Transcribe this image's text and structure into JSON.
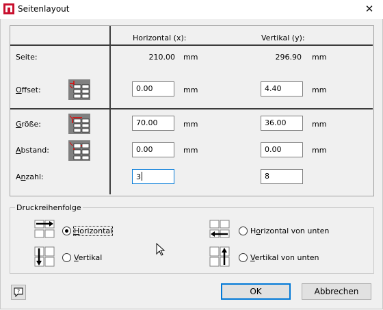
{
  "window": {
    "title": "Seitenlayout",
    "close_glyph": "✕"
  },
  "table": {
    "header_x": "Horizontal (x):",
    "header_y": "Vertikal (y):",
    "unit": "mm",
    "rows": {
      "seite": {
        "label": "Seite:",
        "x": "210.00",
        "y": "296.90"
      },
      "offset": {
        "label": "Offset:",
        "x": "0.00",
        "y": "4.40"
      },
      "groesse": {
        "label": "Größe:",
        "x": "70.00",
        "y": "36.00"
      },
      "abstand": {
        "label": "Abstand:",
        "x": "0.00",
        "y": "0.00"
      },
      "anzahl": {
        "label": "Anzahl:",
        "x": "3",
        "y": "8"
      }
    }
  },
  "print_order": {
    "title": "Druckreihenfolge",
    "options": [
      {
        "label": "Horizontal",
        "checked": true
      },
      {
        "label": "Vertikal",
        "checked": false
      },
      {
        "label": "Horizontal von unten",
        "checked": false
      },
      {
        "label": "Vertikal von unten",
        "checked": false
      }
    ]
  },
  "buttons": {
    "ok": "OK",
    "cancel": "Abbrechen",
    "help_glyph": "?"
  },
  "colors": {
    "accent": "#0078d7",
    "red": "#e00000",
    "icon_gray": "#808080"
  }
}
